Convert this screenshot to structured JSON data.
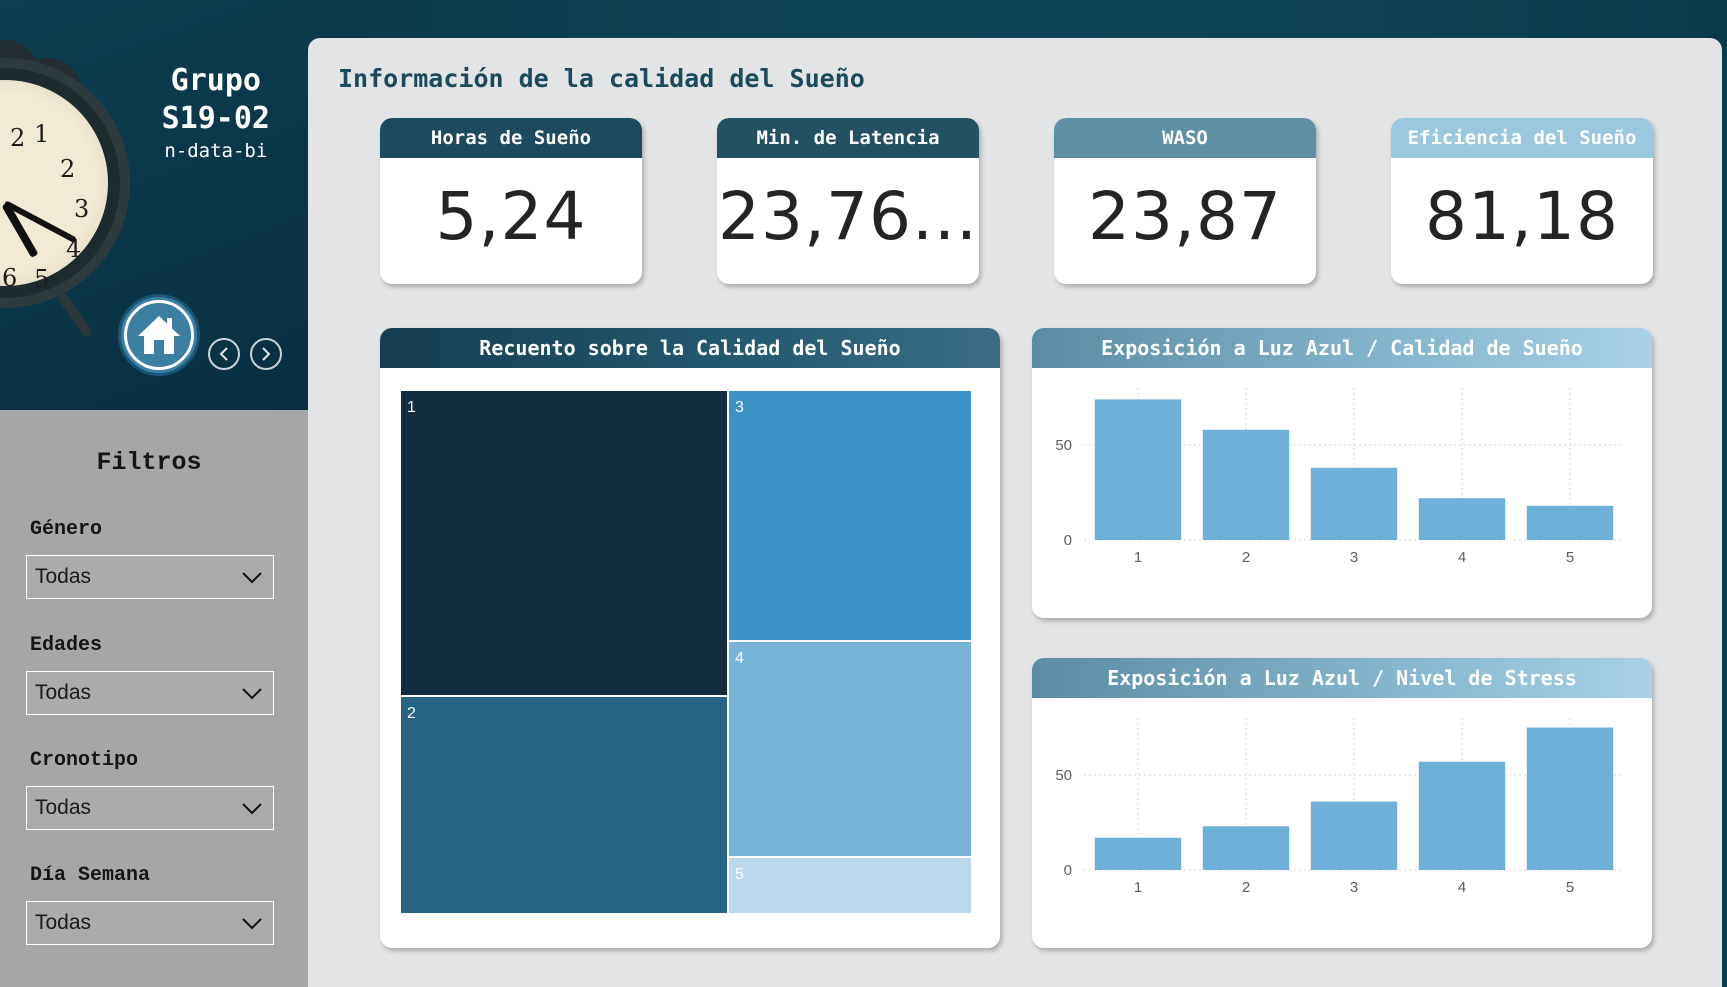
{
  "header": {
    "group_line1": "Grupo",
    "group_line2": "S19-02",
    "subtitle": "n-data-bi"
  },
  "filters": {
    "title": "Filtros",
    "items": [
      {
        "label": "Género",
        "value": "Todas"
      },
      {
        "label": "Edades",
        "value": "Todas"
      },
      {
        "label": "Cronotipo",
        "value": "Todas"
      },
      {
        "label": "Día Semana",
        "value": "Todas"
      }
    ]
  },
  "main": {
    "title": "Información de la calidad del Sueño"
  },
  "kpis": [
    {
      "label": "Horas de Sueño",
      "value": "5,24",
      "header_color": "#1d4a5e"
    },
    {
      "label": "Min. de Latencia",
      "value": "23,76...",
      "header_color": "#235163"
    },
    {
      "label": "WASO",
      "value": "23,87",
      "header_color": "#5f8fa5"
    },
    {
      "label": "Eficiencia del Sueño",
      "value": "81,18",
      "header_color": "#9cc8df"
    }
  ],
  "treemap": {
    "title": "Recuento sobre la Calidad del Sueño",
    "chart_data": {
      "type": "treemap",
      "labels": [
        "1",
        "2",
        "3",
        "4",
        "5"
      ],
      "colors": [
        "#132d40",
        "#266384",
        "#3a91c5",
        "#78b3d8",
        "#bcd8ec"
      ]
    }
  },
  "chart_data": [
    {
      "type": "bar",
      "title": "Exposición a Luz Azul / Calidad de Sueño",
      "categories": [
        "1",
        "2",
        "3",
        "4",
        "5"
      ],
      "values": [
        74,
        58,
        38,
        22,
        18
      ],
      "ylim": [
        0,
        80
      ],
      "yticks": [
        0,
        50
      ],
      "grid": true,
      "bar_color": "#6fb0d8"
    },
    {
      "type": "bar",
      "title": "Exposición a Luz Azul / Nivel de Stress",
      "categories": [
        "1",
        "2",
        "3",
        "4",
        "5"
      ],
      "values": [
        17,
        23,
        36,
        57,
        75
      ],
      "ylim": [
        0,
        80
      ],
      "yticks": [
        0,
        50
      ],
      "grid": true,
      "bar_color": "#6fb0d8"
    }
  ]
}
